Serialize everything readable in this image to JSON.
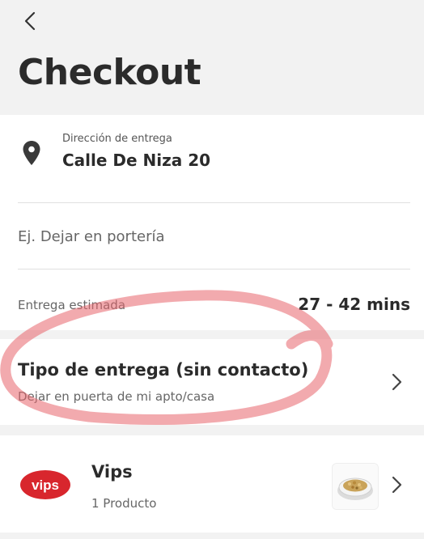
{
  "header": {
    "title": "Checkout"
  },
  "address": {
    "label": "Dirección de entrega",
    "value": "Calle De Niza 20"
  },
  "note": {
    "placeholder": "Ej. Dejar en portería"
  },
  "eta": {
    "label": "Entrega estimada",
    "value": "27 - 42 mins"
  },
  "delivery_type": {
    "title": "Tipo de entrega (sin contacto)",
    "subtitle": "Dejar en puerta de mi apto/casa"
  },
  "store": {
    "name": "Vips",
    "logo_text": "vips",
    "count": "1 Producto"
  },
  "colors": {
    "brand_red": "#d8262d",
    "annotation": "#e8656b"
  },
  "icons": {
    "back": "chevron-left-icon",
    "location": "location-pin-icon",
    "next": "chevron-right-icon"
  }
}
